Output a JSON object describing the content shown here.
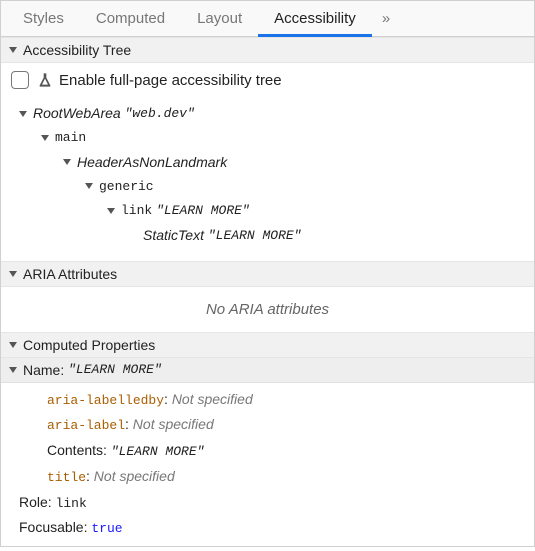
{
  "tabs": {
    "styles": "Styles",
    "computed": "Computed",
    "layout": "Layout",
    "accessibility": "Accessibility",
    "more": "»"
  },
  "sections": {
    "a11y_tree": "Accessibility Tree",
    "aria_attrs": "ARIA Attributes",
    "computed_props": "Computed Properties"
  },
  "enable": {
    "label": "Enable full-page accessibility tree"
  },
  "tree": {
    "root_role": "RootWebArea",
    "root_name": "\"web.dev\"",
    "main": "main",
    "header": "HeaderAsNonLandmark",
    "generic": "generic",
    "link_role": "link",
    "link_name": "\"LEARN MORE\"",
    "static_role": "StaticText",
    "static_name": "\"LEARN MORE\""
  },
  "aria_empty": "No ARIA attributes",
  "props": {
    "name_label": "Name:",
    "name_value": "\"LEARN MORE\"",
    "aria_labelledby": "aria-labelledby",
    "aria_label": "aria-label",
    "title_attr": "title",
    "not_specified": "Not specified",
    "contents_label": "Contents:",
    "contents_value": "\"LEARN MORE\"",
    "role_label": "Role:",
    "role_value": "link",
    "focusable_label": "Focusable:",
    "focusable_value": "true"
  }
}
